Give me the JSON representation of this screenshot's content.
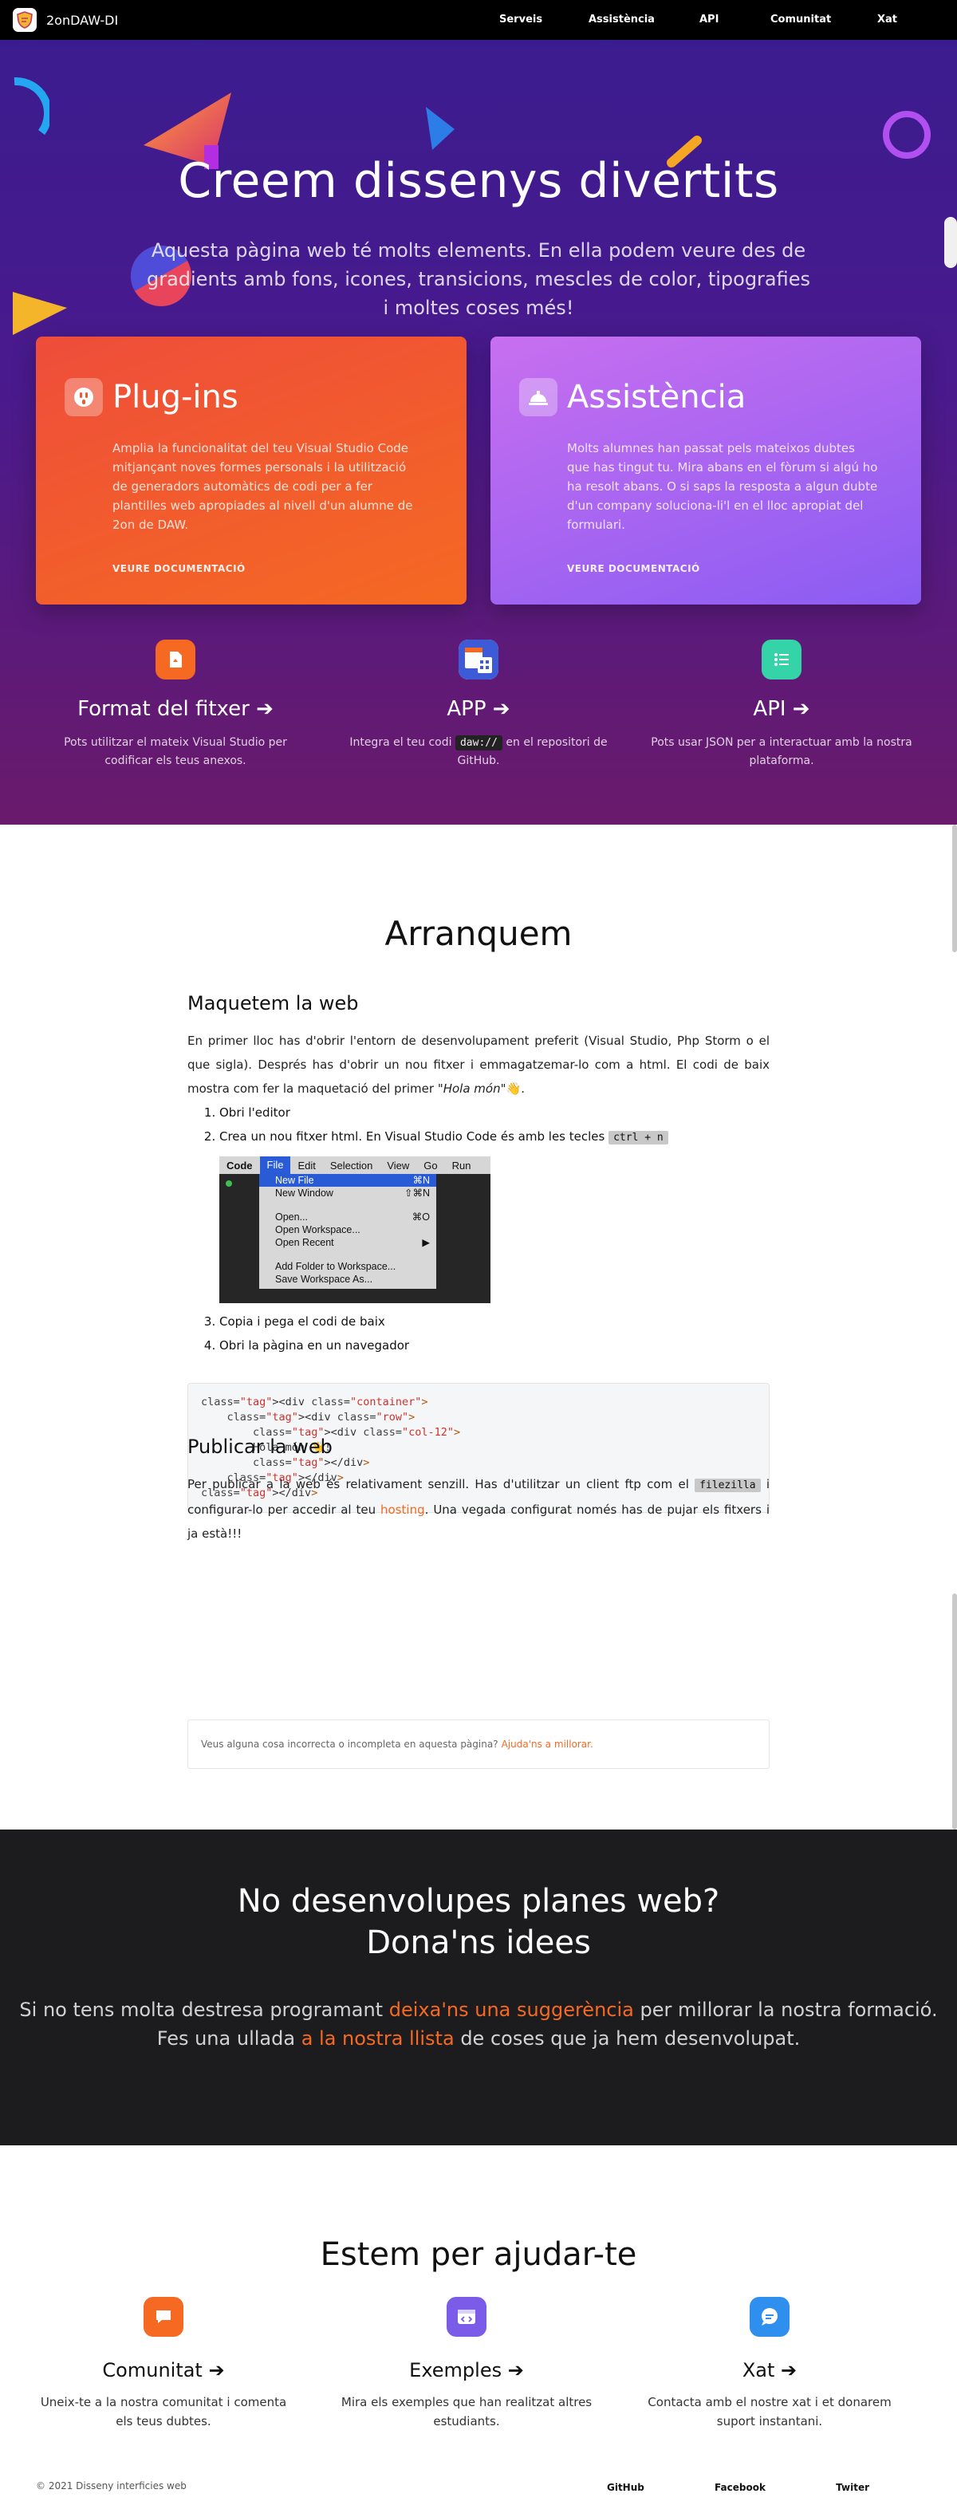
{
  "nav": {
    "brand": "2onDAW-DI",
    "links": [
      "Serveis",
      "Assistència",
      "API",
      "Comunitat",
      "Xat"
    ]
  },
  "hero": {
    "title": "Creem dissenys divertits",
    "lead": "Aquesta pàgina web té molts elements. En ella podem veure des de gradients amb fons, icones, transicions, mescles de color, tipografies i moltes coses més!",
    "cards": [
      {
        "title": "Plug-ins",
        "icon": "plug-icon",
        "text": "Amplia la funcionalitat del teu Visual Studio Code mitjançant noves formes personals i la utilització de generadors automàtics de codi per a fer plantilles web apropiades al nivell d'un alumne de 2on de DAW.",
        "link": "VEURE DOCUMENTACIÓ",
        "color": "#f05a30"
      },
      {
        "title": "Assistència",
        "icon": "service-bell-icon",
        "text": "Molts alumnes han passat pels mateixos dubtes que has tingut tu. Mira abans en el fòrum si algú ho ha resolt abans. O si saps la resposta a algun dubte d'un company soluciona-li'l en el lloc apropiat del formulari.",
        "link": "VEURE DOCUMENTACIÓ",
        "color": "#a366f3"
      }
    ],
    "features": [
      {
        "title": "Format del fitxer ➔",
        "text": "Pots utilitzar el mateix Visual Studio per codificar els teus anexos.",
        "icon": "file-icon",
        "color": "#f56922"
      },
      {
        "title": "APP ➔",
        "text_before": "Integra el teu codi",
        "code": "daw://",
        "text_after": "en el repositori de GitHub.",
        "icon": "app-calendar-icon",
        "color": "#5b6bd8"
      },
      {
        "title": "API ➔",
        "text": "Pots usar JSON per a interactuar amb la nostra plataforma.",
        "icon": "list-icon",
        "color": "#34d3a8"
      }
    ]
  },
  "doc": {
    "heading": "Arranquem",
    "section1": {
      "title": "Maquetem la web",
      "p1": "En primer lloc has d'obrir l'entorn de desenvolupament preferit (Visual Studio, Php Storm o el que sigla). Després has d'obrir un nou fitxer i emmagatzemar-lo com a html. El codi de baix mostra com fer la maquetació del primer",
      "p1_em": "\"Hola món\"",
      "p1_emoji": "👋",
      "steps": [
        "Obri l'editor",
        "Crea un nou fitxer html. En Visual Studio Code és amb les tecles"
      ],
      "shortcut": "ctrl + n",
      "steps_after": [
        "Copia i pega el codi de baix",
        "Obri la pàgina en un navegador"
      ]
    },
    "menu_shot": {
      "bar": [
        "Code",
        "File",
        "Edit",
        "Selection",
        "View",
        "Go",
        "Run"
      ],
      "items": [
        {
          "label": "New File",
          "key": "⌘N",
          "selected": true
        },
        {
          "label": "New Window",
          "key": "⇧⌘N"
        },
        {
          "label": "",
          "key": ""
        },
        {
          "label": "Open...",
          "key": "⌘O"
        },
        {
          "label": "Open Workspace...",
          "key": ""
        },
        {
          "label": "Open Recent",
          "key": "▶"
        },
        {
          "label": "",
          "key": ""
        },
        {
          "label": "Add Folder to Workspace...",
          "key": ""
        },
        {
          "label": "Save Workspace As...",
          "key": ""
        }
      ]
    },
    "code_lines": [
      {
        "indent": 0,
        "html": "<div class=\"container\">"
      },
      {
        "indent": 1,
        "html": "<div class=\"row\">"
      },
      {
        "indent": 2,
        "html": "<div class=\"col-12\">"
      },
      {
        "indent": 2,
        "html": "Hola món 👋!"
      },
      {
        "indent": 2,
        "html": "</div>"
      },
      {
        "indent": 1,
        "html": "</div>"
      },
      {
        "indent": 0,
        "html": "</div>"
      }
    ],
    "section2": {
      "title": "Publicar la web",
      "p_before": "Per publicar a la web és relativament senzill. Has d'utilitzar un client ftp com el",
      "code": "filezilla",
      "p_mid": "i configurar-lo per accedir al teu",
      "link": "hosting",
      "p_after": ". Una vegada configurat només has de pujar els fitxers i ja està!!!"
    },
    "note": {
      "text": "Veus alguna cosa incorrecta o incompleta en aquesta pàgina?",
      "link": "Ajuda'ns a millorar."
    }
  },
  "cta": {
    "title_line1": "No desenvolupes planes web?",
    "title_line2": "Dona'ns idees",
    "l1_before": "Si no tens molta destresa programant",
    "l1_link": "deixa'ns una suggerència",
    "l1_after": "per millorar la nostra formació.",
    "l2_before": "Fes una ullada",
    "l2_link": "a la nostra llista",
    "l2_after": "de coses que ja hem desenvolupat."
  },
  "help": {
    "heading": "Estem per ajudar-te",
    "cols": [
      {
        "title": "Comunitat ➔",
        "text": "Uneix-te a la nostra comunitat i comenta els teus dubtes.",
        "icon": "chat-icon",
        "color": "#f56922"
      },
      {
        "title": "Exemples ➔",
        "text": "Mira els exemples que han realitzat altres estudiants.",
        "icon": "code-window-icon",
        "color": "#7b5ce8"
      },
      {
        "title": "Xat ➔",
        "text": "Contacta amb el nostre xat i et donarem suport instantani.",
        "icon": "message-bubble-icon",
        "color": "#2f8fee"
      }
    ]
  },
  "footer": {
    "copyright": "© 2021 Disseny interficies web",
    "links": [
      "GitHub",
      "Facebook",
      "Twiter"
    ]
  }
}
